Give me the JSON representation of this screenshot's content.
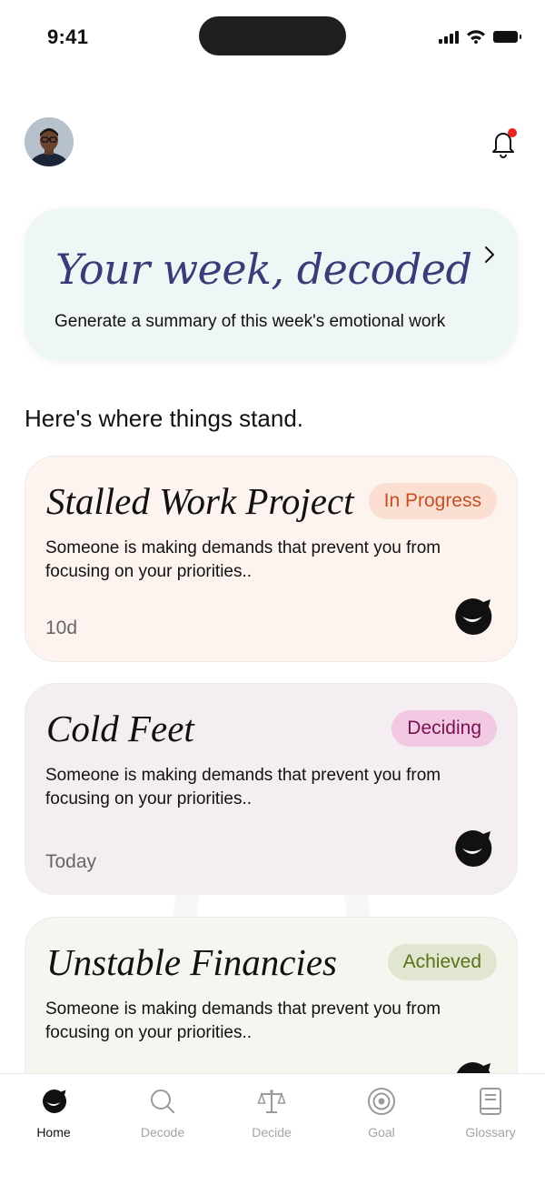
{
  "status_bar": {
    "time": "9:41"
  },
  "header": {
    "avatar_icon": "profile-photo",
    "notification_icon": "bell-icon",
    "has_unread": true
  },
  "summary_card": {
    "title": "Your week, decoded",
    "subtitle": "Generate a summary of this week's emotional work",
    "background": "#eef7f6",
    "title_color": "#3d3a78"
  },
  "section_heading": "Here's where things stand.",
  "cards": [
    {
      "title": "Stalled Work Project",
      "status": "In Progress",
      "description": "Someone is making demands that prevent you from focusing on your priorities..",
      "time": "10d",
      "background": "#fdf4ef"
    },
    {
      "title": "Cold Feet",
      "status": "Deciding",
      "description": "Someone is making demands that prevent you from focusing on your priorities..",
      "time": "Today",
      "background": "#f4eef2"
    },
    {
      "title": "Unstable Financies",
      "status": "Achieved",
      "description": "Someone is making demands that prevent you from focusing on your priorities..",
      "time": "",
      "background": "#f6f6f0"
    }
  ],
  "tab_bar": {
    "active": "Home",
    "tabs": [
      {
        "label": "Home",
        "icon": "mascot-icon"
      },
      {
        "label": "Decode",
        "icon": "search-icon"
      },
      {
        "label": "Decide",
        "icon": "scale-icon"
      },
      {
        "label": "Goal",
        "icon": "target-icon"
      },
      {
        "label": "Glossary",
        "icon": "book-icon"
      }
    ]
  }
}
